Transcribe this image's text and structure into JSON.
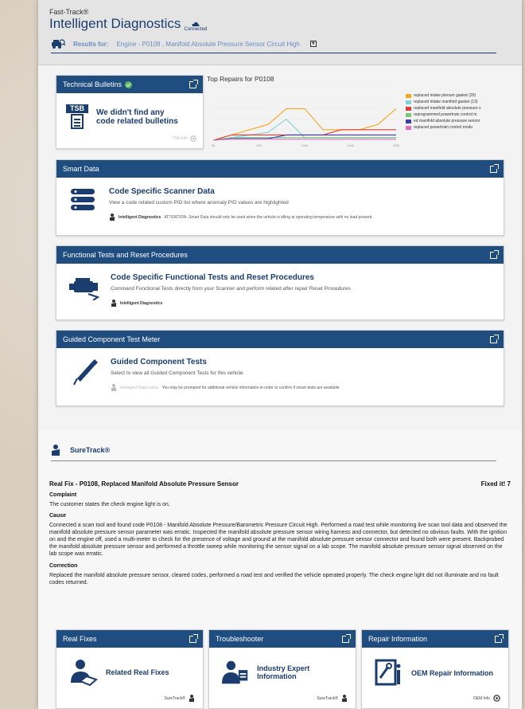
{
  "header": {
    "brand_small": "Fast-Track®",
    "title": "Intelligent Diagnostics",
    "connected": "Connected",
    "results_label": "Results for:",
    "results_value": "Engine  -  P0108 ,  Manifold Absolute Pressure Sensor Circuit High"
  },
  "bulletins": {
    "title": "Technical Bulletins",
    "icon_text": "TSB",
    "message": "We didn't find any code related bulletins",
    "footer": "TSB Info"
  },
  "chart_data": {
    "type": "line",
    "title": "Top Repairs for P0108",
    "x": [
      0,
      1,
      2,
      3,
      4,
      5,
      6,
      7,
      8,
      9,
      10
    ],
    "x_tick_labels": [
      "0k",
      "50k",
      "100k",
      "150k",
      "200k"
    ],
    "ylim": [
      0,
      10
    ],
    "series": [
      {
        "name": "replaced intake plenum gasket (20)",
        "color": "#f5a623",
        "values": [
          0,
          1,
          2,
          3,
          6,
          6,
          2,
          2,
          2,
          3,
          6
        ]
      },
      {
        "name": "replaced intake manifold gasket (13)",
        "color": "#7fd3d8",
        "values": [
          0,
          0.5,
          1,
          1.5,
          4,
          0.5,
          0.5,
          0.5,
          0.5,
          0.5,
          0.5
        ]
      },
      {
        "name": "replaced manifold absolute pressure s",
        "color": "#e03c31",
        "values": [
          0,
          1,
          1,
          1,
          1,
          1,
          1,
          2,
          2,
          2,
          2
        ]
      },
      {
        "name": "reprogrammed powertrain control m",
        "color": "#7bc67a",
        "values": [
          0,
          0.5,
          0.5,
          0.5,
          0.5,
          0.5,
          0.5,
          0.5,
          0.5,
          0.5,
          0.5
        ]
      },
      {
        "name": "ed manifold absolute pressure sensor",
        "color": "#3a3fa8",
        "values": [
          0,
          0.3,
          0.3,
          0.3,
          1,
          1,
          1,
          1,
          1,
          1,
          1
        ]
      },
      {
        "name": "replaced powertrain control modu",
        "color": "#e070c8",
        "values": [
          0,
          0.2,
          0.2,
          0.2,
          0.2,
          0.2,
          0.2,
          0.2,
          0.2,
          0.2,
          0.2
        ]
      }
    ]
  },
  "smart_data": {
    "header": "Smart Data",
    "title": "Code Specific Scanner Data",
    "desc": "View a code related custom PID list where anomaly PID values are highlighted",
    "note_source": "Intelligent Diagnostics",
    "note_text": "ATTENTION: Smart Data should only be used when the vehicle is idling at operating temperature with no load present."
  },
  "functional": {
    "header": "Functional Tests and Reset Procedures",
    "title": "Code Specific Functional Tests and Reset Procedures",
    "desc": "Command Functional Tests directly from your Scanner and perform related after repair Reset Procedures",
    "note_source": "Intelligent Diagnostics"
  },
  "guided": {
    "header": "Guided Component Test Meter",
    "title": "Guided Component Tests",
    "desc": "Select to view all Guided Component Tests for this vehicle",
    "note_source": "Intelligent Diagnostics",
    "note_text": "You may be prompted for additional vehicle information in order to confirm if smart tests are available"
  },
  "suretrack": {
    "title": "SureTrack®",
    "realfix_title": "Real Fix - P0108, Replaced Manifold Absolute Pressure Sensor",
    "fixed_it": "Fixed it! 7",
    "complaint_h": "Complaint",
    "complaint": "The customer states the check engine light is on.",
    "cause_h": "Cause",
    "cause": "Connected a scan tool and found code P0108 - Manifold Absolute Pressure/Barometric Pressure Circuit High. Performed a road test while monitoring live scan tool data and observed the manifold absolute pressure sensor parameter was erratic. Inspected the manifold absolute pressure sensor wiring harness and connector, but detected no obvious faults. With the ignition on and the engine off, used a multi-meter to check for the presence of voltage and ground at the manifold absolute pressure sensor connector and found both were present. Backprobed the manifold absolute pressure sensor and performed a throttle sweep while monitoring the sensor signal on a lab scope. The manifold absolute pressure sensor signal observed on the lab scope was erratic.",
    "correction_h": "Correction",
    "correction": "Replaced the manifold absolute pressure sensor, cleared codes, performed a road test and verified the vehicle operated properly. The check engine light did not illuminate and no fault codes returned."
  },
  "cards": [
    {
      "header": "Real Fixes",
      "title": "Related Real Fixes",
      "foot": "SureTrack®"
    },
    {
      "header": "Troubleshooter",
      "title": "Industry Expert Information",
      "foot": "SureTrack®"
    },
    {
      "header": "Repair Information",
      "title": "OEM Repair Information",
      "foot": "OEM Info"
    }
  ]
}
